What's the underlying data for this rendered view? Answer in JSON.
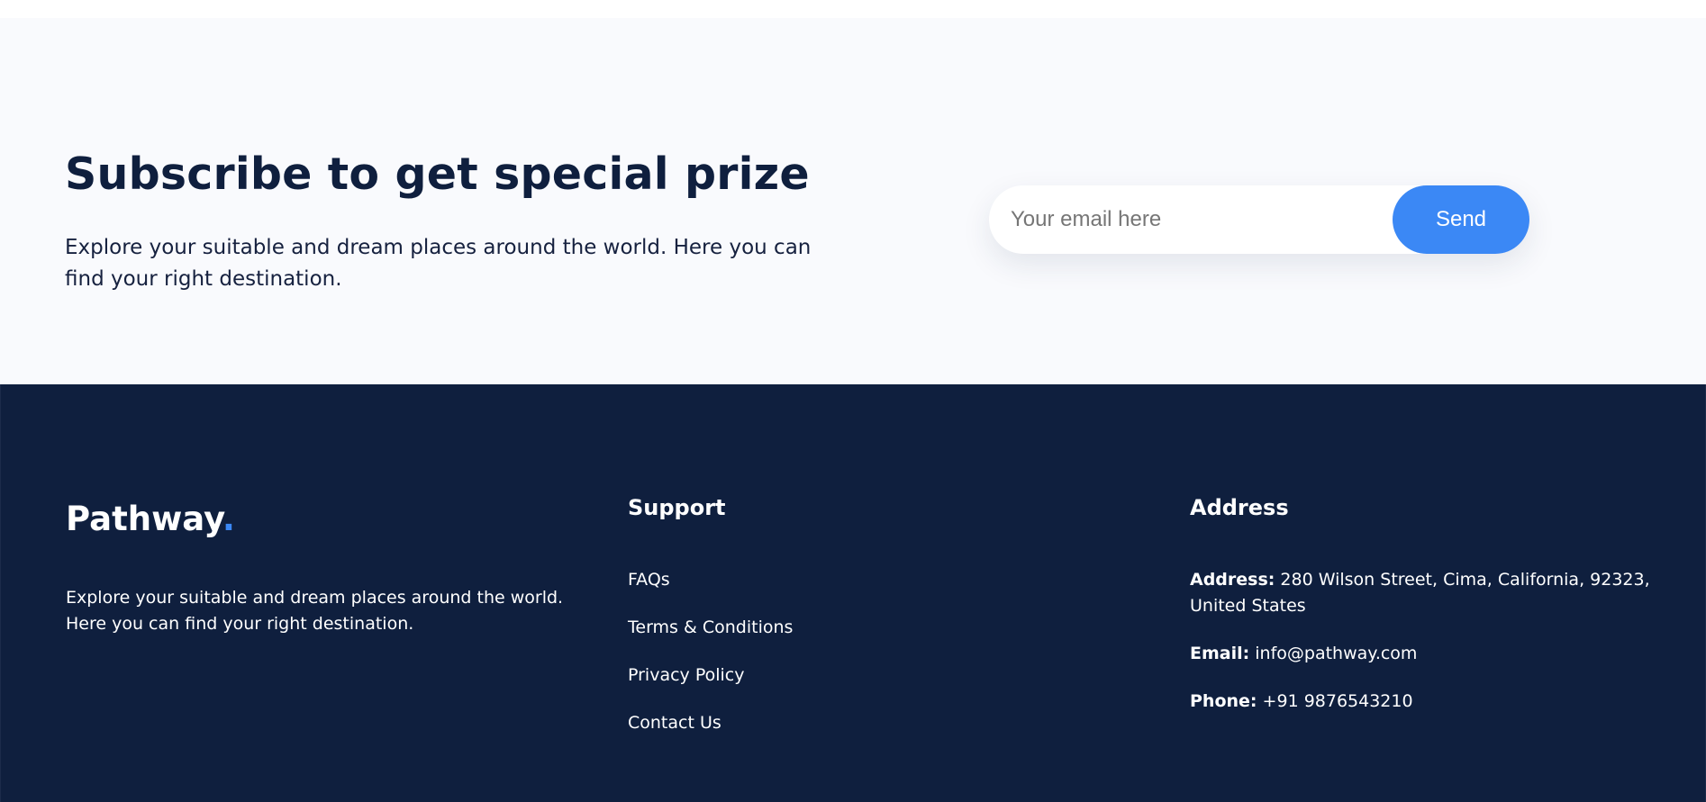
{
  "subscribe": {
    "title": "Subscribe to get special prize",
    "description": "Explore your suitable and dream places around the world. Here you can find your right destination.",
    "email_placeholder": "Your email here",
    "send_label": "Send"
  },
  "footer": {
    "brand_name": "Pathway",
    "brand_dot": ".",
    "brand_description": "Explore your suitable and dream places around the world. Here you can find your right destination.",
    "support": {
      "heading": "Support",
      "links": [
        {
          "label": "FAQs"
        },
        {
          "label": "Terms & Conditions"
        },
        {
          "label": "Privacy Policy"
        },
        {
          "label": "Contact Us"
        }
      ]
    },
    "address": {
      "heading": "Address",
      "address_key": "Address:",
      "address_value": " 280 Wilson Street, Cima, California, 92323, United States",
      "email_key": "Email:",
      "email_value": " info@pathway.com",
      "phone_key": "Phone:",
      "phone_value": " +91 9876543210"
    }
  },
  "colors": {
    "navy": "#0f1f3e",
    "accent_blue": "#3b88f5",
    "subscribe_bg": "#f9fafd"
  }
}
